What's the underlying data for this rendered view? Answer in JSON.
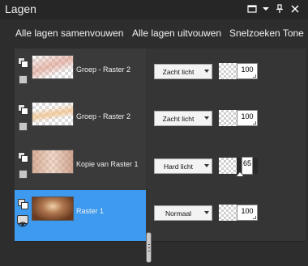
{
  "panel": {
    "title": "Lagen"
  },
  "window_controls": [
    {
      "name": "restore-icon",
      "glyph": ""
    },
    {
      "name": "menu-icon",
      "glyph": "▾"
    },
    {
      "name": "pin-icon",
      "glyph": "⊥"
    },
    {
      "name": "close-icon",
      "glyph": "✕"
    }
  ],
  "toolbar": {
    "collapse_all": "Alle lagen samenvouwen",
    "expand_all": "Alle lagen uitvouwen",
    "quick_search": "Snelzoeken Tone"
  },
  "layers": [
    {
      "name": "Groep - Raster 2",
      "blend_mode": "Zacht licht",
      "opacity": "100",
      "selected": false,
      "visible_icon": "visibility-box-icon",
      "thumb_tint": "#e8b0a0"
    },
    {
      "name": "Groep - Raster 2",
      "blend_mode": "Zacht licht",
      "opacity": "100",
      "selected": false,
      "visible_icon": "visibility-box-icon",
      "thumb_tint": "#f0c890"
    },
    {
      "name": "Kopie van Raster 1",
      "blend_mode": "Hard licht",
      "opacity": "65",
      "selected": false,
      "visible_icon": "visibility-box-icon",
      "thumb_tint": "#c89078"
    },
    {
      "name": "Raster 1",
      "blend_mode": "Normaal",
      "opacity": "100",
      "selected": true,
      "visible_icon": "eye-icon",
      "thumb_tint": "#8a5a3a"
    }
  ],
  "colors": {
    "selected_row": "#3d9aef",
    "panel_bg": "#2d2d2d"
  }
}
